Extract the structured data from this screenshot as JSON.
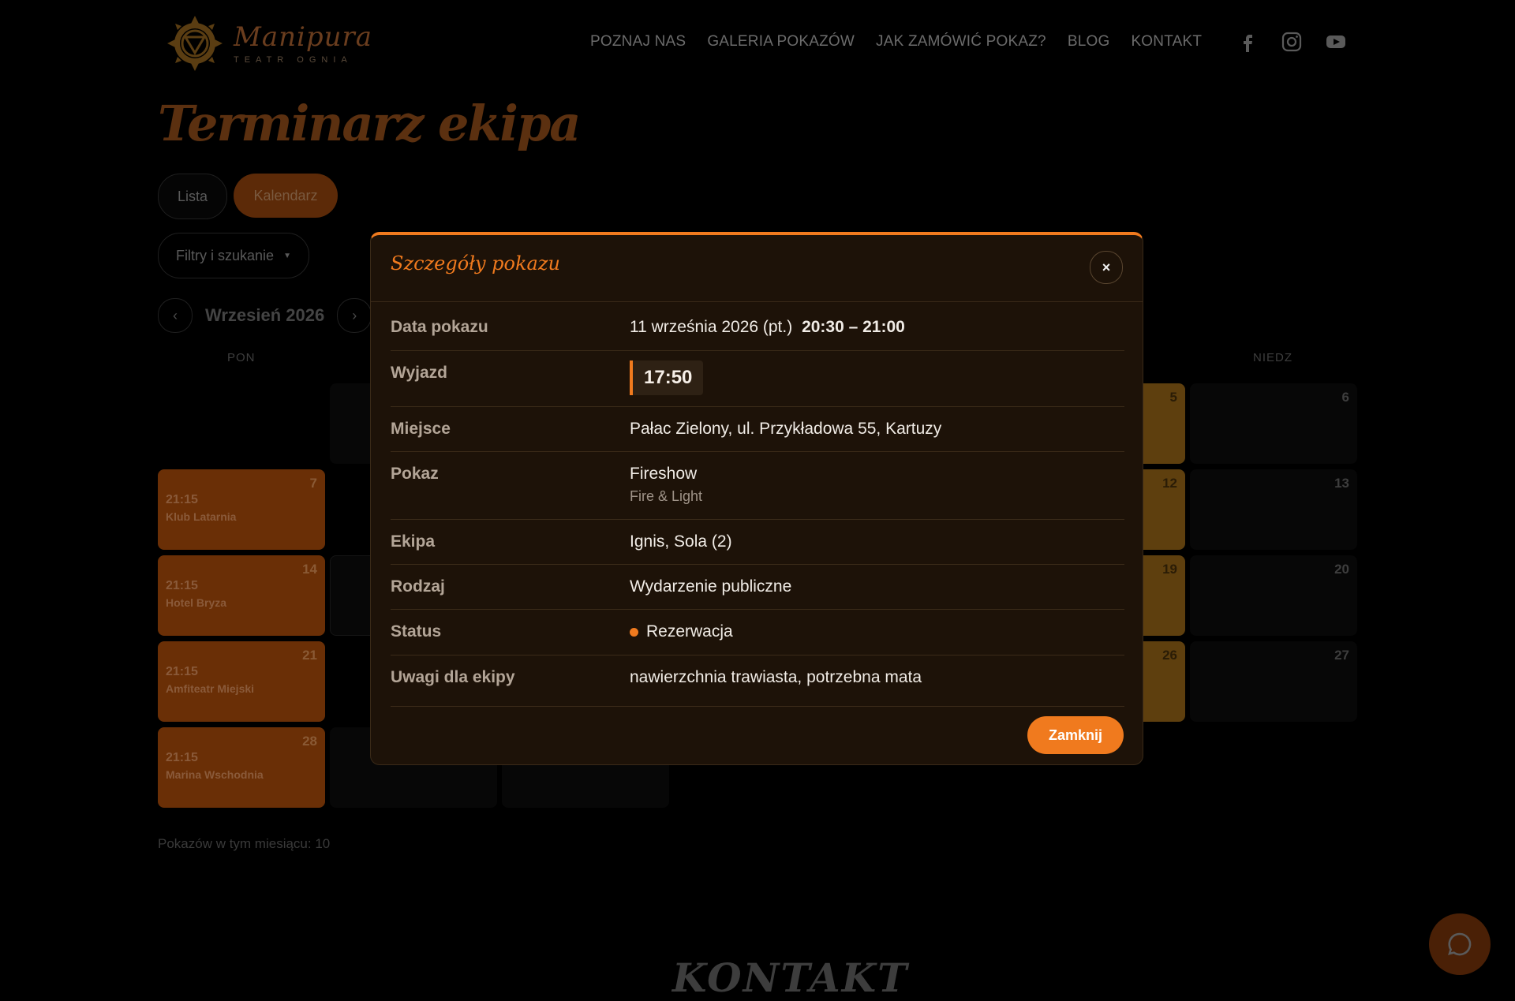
{
  "brand": {
    "name": "Manipura",
    "tagline": "TEATR OGNIA"
  },
  "nav": [
    "POZNAJ NAS",
    "GALERIA POKAZÓW",
    "JAK ZAMÓWIĆ POKAZ?",
    "BLOG",
    "KONTAKT"
  ],
  "page_title": "Terminarz ekipa",
  "view_toggle": {
    "list": "Lista",
    "calendar": "Kalendarz"
  },
  "filters_label": "Filtry i szukanie",
  "month": {
    "prev": "‹",
    "label": "Wrzesień 2026",
    "next": "›"
  },
  "weekdays": {
    "mon": "PON",
    "sun": "NIEDZ"
  },
  "calendar": {
    "monday_events": [
      {
        "day": "7",
        "time": "21:15",
        "place": "Klub Latarnia"
      },
      {
        "day": "14",
        "time": "21:15",
        "place": "Hotel Bryza"
      },
      {
        "day": "21",
        "time": "21:15",
        "place": "Amfiteatr Miejski"
      },
      {
        "day": "28",
        "time": "21:15",
        "place": "Marina Wschodnia"
      }
    ],
    "saturday_days": [
      "5",
      "12",
      "19",
      "26"
    ],
    "sunday_days": [
      "6",
      "13",
      "20",
      "27"
    ]
  },
  "count_note": "Pokazów w tym miesiącu: 10",
  "footer_heading": "KONTAKT",
  "modal": {
    "title": "Szczegóły pokazu",
    "close_symbol": "×",
    "rows": {
      "date": {
        "label": "Data pokazu",
        "value": "11 września 2026 (pt.)",
        "time": "20:30 – 21:00"
      },
      "departure": {
        "label": "Wyjazd",
        "value": "17:50"
      },
      "place": {
        "label": "Miejsce",
        "value": "Pałac Zielony, ul. Przykładowa 55, Kartuzy"
      },
      "show": {
        "label": "Pokaz",
        "value": "Fireshow",
        "sub": "Fire & Light"
      },
      "crew": {
        "label": "Ekipa",
        "value": "Ignis, Sola (2)"
      },
      "type": {
        "label": "Rodzaj",
        "value": "Wydarzenie publiczne"
      },
      "status": {
        "label": "Status",
        "value": "Rezerwacja"
      },
      "notes": {
        "label": "Uwagi dla ekipy",
        "value": "nawierzchnia trawiasta, potrzebna mata"
      }
    },
    "close_button": "Zamknij"
  },
  "colors": {
    "accent": "#f07a1e",
    "modal_bg": "#1d1208",
    "monday_cell": "#6a2f06",
    "saturday_cell": "#5e3f0e"
  },
  "icons": [
    "manipura-logo-icon",
    "facebook-icon",
    "instagram-icon",
    "youtube-icon",
    "chat-bubble-icon",
    "close-icon"
  ]
}
